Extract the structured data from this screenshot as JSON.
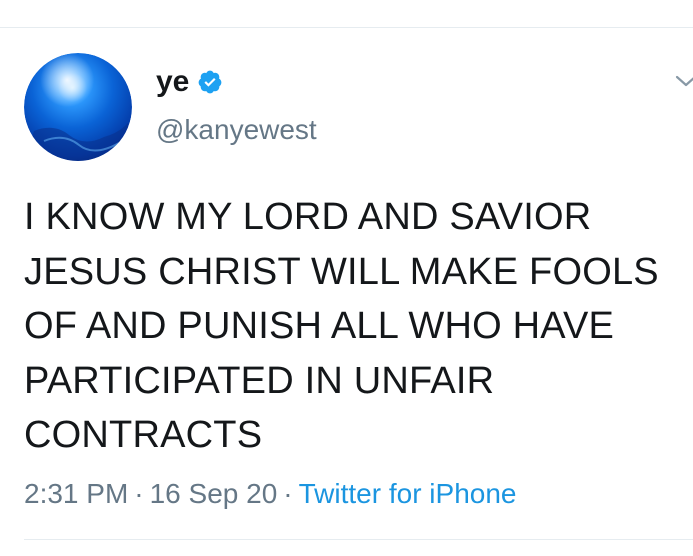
{
  "tweet": {
    "display_name": "ye",
    "handle": "@kanyewest",
    "text": "I KNOW MY LORD AND SAVIOR JESUS CHRIST WILL MAKE FOOLS OF AND PUNISH ALL WHO HAVE PARTICIPATED IN UNFAIR CONTRACTS",
    "time": "2:31 PM",
    "date": "16 Sep 20",
    "separator": "·",
    "source": "Twitter for iPhone"
  },
  "icons": {
    "avatar": "blue-globe-avatar",
    "verified": "verified-badge-icon",
    "menu": "chevron-down-icon"
  },
  "colors": {
    "text": "#14171a",
    "secondary": "#657786",
    "link": "#1b95e0",
    "verified": "#1da1f2",
    "divider": "#e6ecf0"
  }
}
